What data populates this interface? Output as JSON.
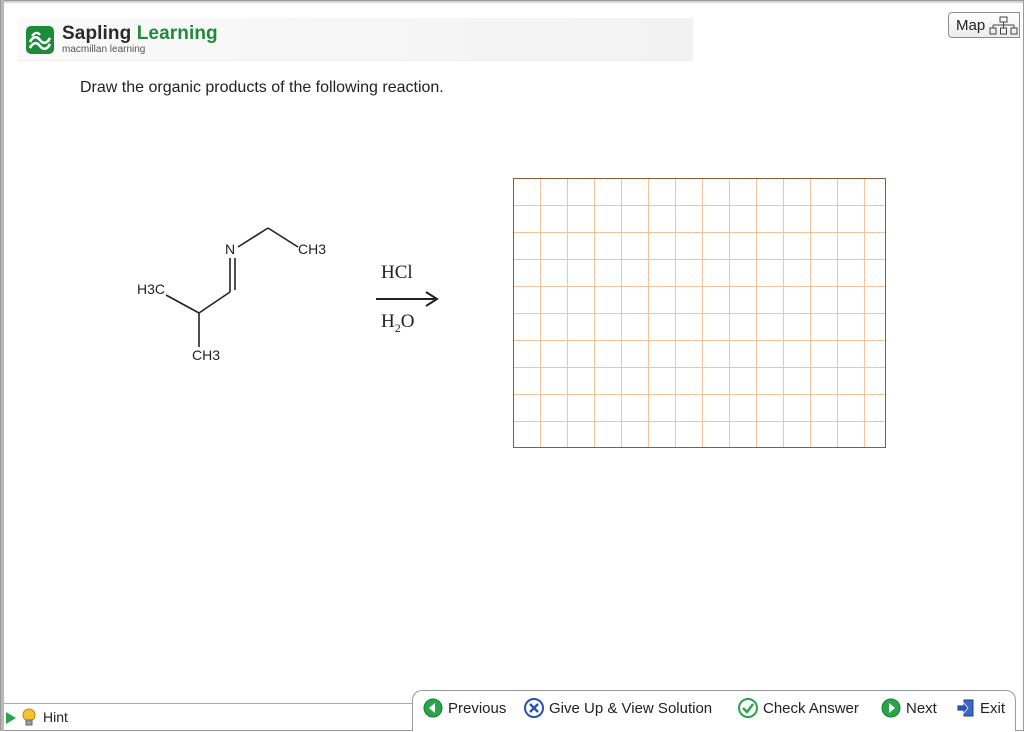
{
  "brand": {
    "name_primary": "Sapling",
    "name_accent": "Learning",
    "subtitle": "macmillan learning",
    "accent_color": "#1f8a3c"
  },
  "map_button": {
    "label": "Map",
    "icon": "sitemap-icon"
  },
  "question": {
    "prompt": "Draw the organic products of the following reaction."
  },
  "molecule": {
    "atoms": {
      "n": "N",
      "ch3_right": "CH3",
      "h3c_left": "H3C",
      "ch3_bottom": "CH3"
    }
  },
  "reaction": {
    "reagent_top": "HCl",
    "reagent_bottom_main": "H",
    "reagent_bottom_sub": "2",
    "reagent_bottom_end": "O"
  },
  "canvas": {
    "grid_color": "#f3c39e"
  },
  "footer": {
    "hint": "Hint",
    "previous": "Previous",
    "give_up": "Give Up & View Solution",
    "check_answer": "Check Answer",
    "next": "Next",
    "exit": "Exit"
  }
}
